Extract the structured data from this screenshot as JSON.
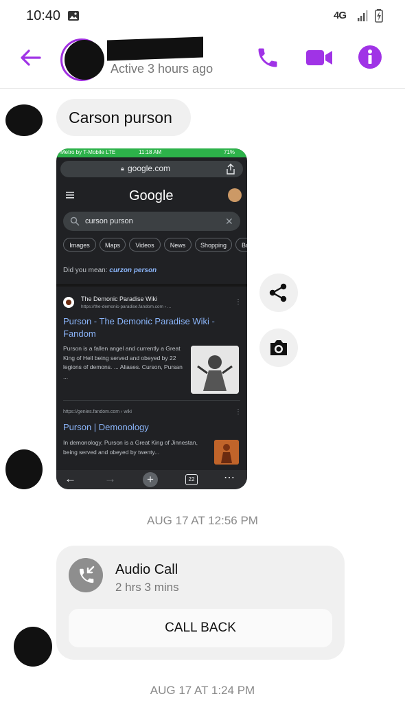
{
  "status_bar": {
    "time": "10:40",
    "network": "4G"
  },
  "header": {
    "active_status": "Active 3 hours ago"
  },
  "messages": {
    "first_text": "Carson purson",
    "timestamp_1": "AUG 17 AT 12:56 PM",
    "timestamp_2": "AUG 17 AT 1:24 PM"
  },
  "screenshot": {
    "status_left": "Metro by T-Mobile  LTE",
    "status_time": "11:18 AM",
    "status_right": "71%",
    "url": "google.com",
    "logo": "Google",
    "query": "curson purson",
    "chips": [
      "Images",
      "Maps",
      "Videos",
      "News",
      "Shopping",
      "Bo"
    ],
    "did_you_mean_label": "Did you mean:",
    "did_you_mean_link": "curzon person",
    "result1": {
      "site": "The Demonic Paradise Wiki",
      "url": "https://the-demonic-paradise.fandom.com › ...",
      "title": "Purson - The Demonic Paradise Wiki - Fandom",
      "snippet": "Purson is a fallen angel and currently a Great King of Hell being served and obeyed by 22 legions of demons. ... Aliases. Curson, Pursan ..."
    },
    "result2": {
      "url": "https://genies.fandom.com › wiki",
      "title": "Purson | Demonology",
      "snippet": "In demonology, Purson is a Great King of Jinnestan, being served and obeyed by twenty..."
    },
    "tab_count": "22"
  },
  "call_card": {
    "title": "Audio Call",
    "duration": "2 hrs 3 mins",
    "callback_label": "CALL BACK"
  },
  "colors": {
    "accent": "#a033e6",
    "bubble": "#f0f0f0"
  }
}
